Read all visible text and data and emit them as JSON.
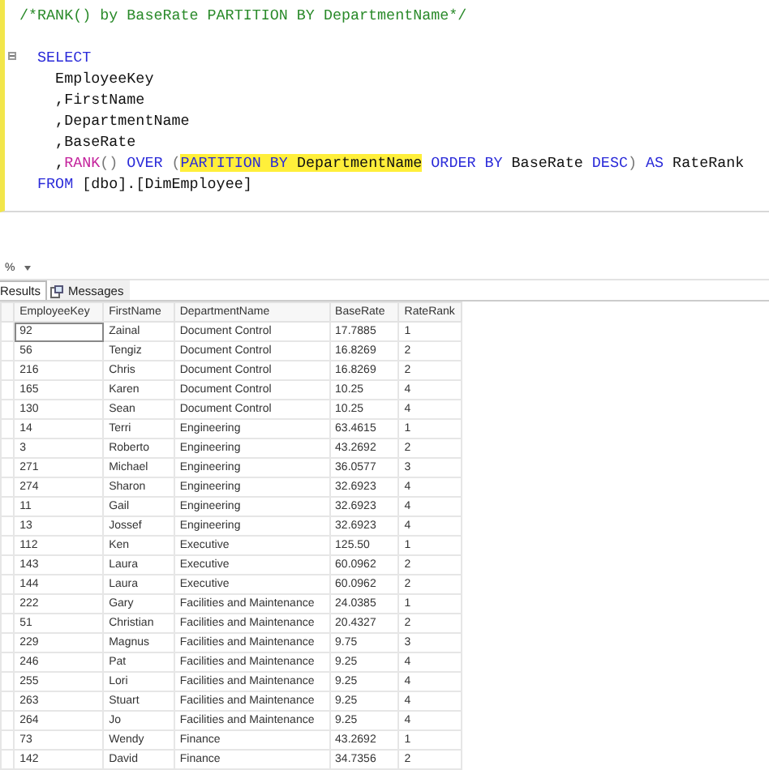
{
  "editor": {
    "header": {
      "tokens": [
        {
          "kind": "comment",
          "text": "/*RANK() by BaseRate PARTITION BY DepartmentName*/"
        }
      ]
    },
    "lines": [
      {
        "collapsible": true,
        "tokens": [
          {
            "kind": "keyword",
            "text": "  SELECT"
          }
        ]
      },
      {
        "tokens": [
          {
            "kind": "plain",
            "text": "    EmployeeKey"
          }
        ]
      },
      {
        "tokens": [
          {
            "kind": "plain",
            "text": "    ,FirstName"
          }
        ]
      },
      {
        "tokens": [
          {
            "kind": "plain",
            "text": "    ,DepartmentName"
          }
        ]
      },
      {
        "tokens": [
          {
            "kind": "plain",
            "text": "    ,BaseRate"
          }
        ]
      },
      {
        "tokens": [
          {
            "kind": "plain",
            "text": "    ,"
          },
          {
            "kind": "function",
            "text": "RANK"
          },
          {
            "kind": "punct",
            "text": "()"
          },
          {
            "kind": "keyword",
            "text": " OVER "
          },
          {
            "kind": "punct",
            "text": "("
          },
          {
            "kind": "highlighted-keyword",
            "text": "PARTITION BY"
          },
          {
            "kind": "highlighted-plain",
            "text": " DepartmentName"
          },
          {
            "kind": "keyword",
            "text": " ORDER BY"
          },
          {
            "kind": "plain",
            "text": " BaseRate "
          },
          {
            "kind": "keyword",
            "text": "DESC"
          },
          {
            "kind": "punct",
            "text": ")"
          },
          {
            "kind": "keyword",
            "text": " AS"
          },
          {
            "kind": "plain",
            "text": " RateRank"
          }
        ]
      },
      {
        "tokens": [
          {
            "kind": "keyword",
            "text": "  FROM"
          },
          {
            "kind": "plain",
            "text": " [dbo].[DimEmployee]"
          }
        ]
      }
    ]
  },
  "zoom": {
    "value": "%"
  },
  "tabs": [
    {
      "label": "Results",
      "selected": true
    },
    {
      "label": "Messages",
      "selected": false
    }
  ],
  "grid": {
    "columns": [
      "EmployeeKey",
      "FirstName",
      "DepartmentName",
      "BaseRate",
      "RateRank"
    ],
    "rows": [
      {
        "focused": true,
        "cells": [
          "92",
          "Zainal",
          "Document Control",
          "17.7885",
          "1"
        ]
      },
      {
        "focused": false,
        "cells": [
          "56",
          "Tengiz",
          "Document Control",
          "16.8269",
          "2"
        ]
      },
      {
        "focused": false,
        "cells": [
          "216",
          "Chris",
          "Document Control",
          "16.8269",
          "2"
        ]
      },
      {
        "focused": false,
        "cells": [
          "165",
          "Karen",
          "Document Control",
          "10.25",
          "4"
        ]
      },
      {
        "focused": false,
        "cells": [
          "130",
          "Sean",
          "Document Control",
          "10.25",
          "4"
        ]
      },
      {
        "focused": false,
        "cells": [
          "14",
          "Terri",
          "Engineering",
          "63.4615",
          "1"
        ]
      },
      {
        "focused": false,
        "cells": [
          "3",
          "Roberto",
          "Engineering",
          "43.2692",
          "2"
        ]
      },
      {
        "focused": false,
        "cells": [
          "271",
          "Michael",
          "Engineering",
          "36.0577",
          "3"
        ]
      },
      {
        "focused": false,
        "cells": [
          "274",
          "Sharon",
          "Engineering",
          "32.6923",
          "4"
        ]
      },
      {
        "focused": false,
        "cells": [
          "11",
          "Gail",
          "Engineering",
          "32.6923",
          "4"
        ]
      },
      {
        "focused": false,
        "cells": [
          "13",
          "Jossef",
          "Engineering",
          "32.6923",
          "4"
        ]
      },
      {
        "focused": false,
        "cells": [
          "112",
          "Ken",
          "Executive",
          "125.50",
          "1"
        ]
      },
      {
        "focused": false,
        "cells": [
          "143",
          "Laura",
          "Executive",
          "60.0962",
          "2"
        ]
      },
      {
        "focused": false,
        "cells": [
          "144",
          "Laura",
          "Executive",
          "60.0962",
          "2"
        ]
      },
      {
        "focused": false,
        "cells": [
          "222",
          "Gary",
          "Facilities and Maintenance",
          "24.0385",
          "1"
        ]
      },
      {
        "focused": false,
        "cells": [
          "51",
          "Christian",
          "Facilities and Maintenance",
          "20.4327",
          "2"
        ]
      },
      {
        "focused": false,
        "cells": [
          "229",
          "Magnus",
          "Facilities and Maintenance",
          "9.75",
          "3"
        ]
      },
      {
        "focused": false,
        "cells": [
          "246",
          "Pat",
          "Facilities and Maintenance",
          "9.25",
          "4"
        ]
      },
      {
        "focused": false,
        "cells": [
          "255",
          "Lori",
          "Facilities and Maintenance",
          "9.25",
          "4"
        ]
      },
      {
        "focused": false,
        "cells": [
          "263",
          "Stuart",
          "Facilities and Maintenance",
          "9.25",
          "4"
        ]
      },
      {
        "focused": false,
        "cells": [
          "264",
          "Jo",
          "Facilities and Maintenance",
          "9.25",
          "4"
        ]
      },
      {
        "focused": false,
        "cells": [
          "73",
          "Wendy",
          "Finance",
          "43.2692",
          "1"
        ]
      },
      {
        "focused": false,
        "cells": [
          "142",
          "David",
          "Finance",
          "34.7356",
          "2"
        ]
      }
    ]
  }
}
